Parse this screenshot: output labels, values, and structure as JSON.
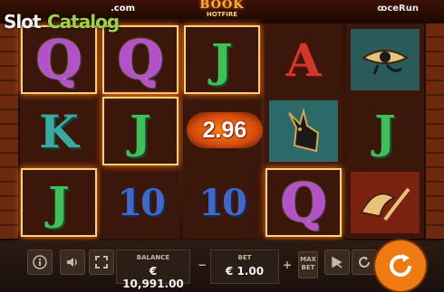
{
  "watermark": {
    "slot": "Slot",
    "catalog": "Catalog",
    "com": ".com"
  },
  "game": {
    "logo_top": "BOOK",
    "logo_bottom": "HOTFIRE",
    "provider": "ꝏceRun"
  },
  "reels": [
    [
      "Q",
      "K",
      "J"
    ],
    [
      "Q",
      "J",
      "10"
    ],
    [
      "J",
      "",
      "10"
    ],
    [
      "A",
      "anubis",
      "Q"
    ],
    [
      "eye",
      "J",
      "wings"
    ]
  ],
  "win_amount": "2.96",
  "panel": {
    "balance_label": "BALANCE",
    "balance_value": "€ 10,991.00",
    "bet_label": "BET",
    "bet_value": "€ 1.00",
    "bet_minus": "−",
    "bet_plus": "+",
    "max_bet_line1": "MAX",
    "max_bet_line2": "BET"
  },
  "icons": [
    "info-icon",
    "sound-icon",
    "fullscreen-icon",
    "turbo-icon",
    "autoplay-icon",
    "spin-icon"
  ],
  "colors": {
    "spin_button": "#f07a12",
    "win_text": "#ffffff"
  }
}
